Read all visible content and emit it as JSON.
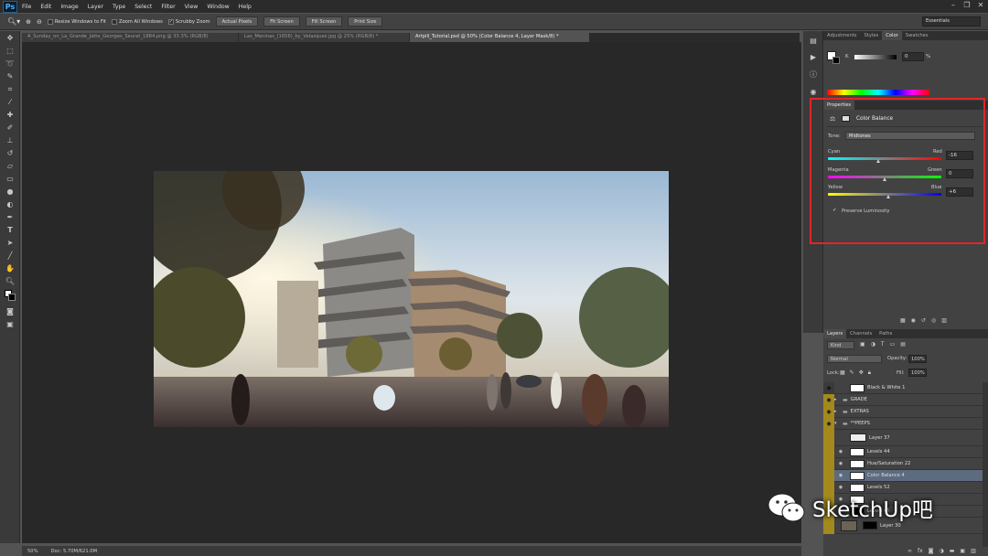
{
  "app": {
    "logo": "Ps"
  },
  "menu": [
    "File",
    "Edit",
    "Image",
    "Layer",
    "Type",
    "Select",
    "Filter",
    "View",
    "Window",
    "Help"
  ],
  "options": {
    "resize_windows": "Resize Windows to Fit",
    "zoom_all": "Zoom All Windows",
    "scrubby": "Scrubby Zoom",
    "actual_pixels": "Actual Pixels",
    "fit_screen": "Fit Screen",
    "fill_screen": "Fill Screen",
    "print_size": "Print Size",
    "workspace": "Essentials"
  },
  "tabs": [
    "A_Sunday_on_La_Grande_Jatte_Georges_Seurat_1884.png @ 33.3% (RGB/8)",
    "Las_Meninas_(1656)_by_Velazquez.jpg @ 25% (RGB/8) *",
    "Artpill_Tutorial.psd @ 50% (Color Balance 4, Layer Mask/8) *"
  ],
  "status": {
    "zoom": "50%",
    "doc": "Doc: 5.70M/621.0M"
  },
  "color_panel": {
    "tabs": [
      "Adjustments",
      "Styles",
      "Color",
      "Swatches"
    ],
    "k_label": "K",
    "k_value": "0",
    "pct": "%"
  },
  "properties": {
    "tab": "Properties",
    "title": "Color Balance",
    "tone_label": "Tone:",
    "tone_value": "Midtones",
    "cyan": "Cyan",
    "red": "Red",
    "cyan_red_value": "-16",
    "magenta": "Magenta",
    "green": "Green",
    "magenta_green_value": "0",
    "yellow": "Yellow",
    "blue": "Blue",
    "yellow_blue_value": "+6",
    "preserve": "Preserve Luminosity"
  },
  "layers_panel": {
    "tabs": [
      "Layers",
      "Channels",
      "Paths"
    ],
    "kind": "Kind",
    "blend": "Normal",
    "opacity_label": "Opacity:",
    "opacity": "100%",
    "lock_label": "Lock:",
    "fill_label": "Fill:",
    "fill": "100%",
    "layers": [
      "Black & White 1",
      "GRADE",
      "EXTRAS",
      "**PEEPS",
      "Layer 37",
      "Levels 44",
      "Hue/Saturation 22",
      "Color Balance 4",
      "Levels 52",
      "",
      "Levels 45",
      "Layer 30"
    ]
  },
  "watermark": "SketchUp吧",
  "colors": {
    "accent_red": "#e0262a",
    "layer_eye": "#a48a1d"
  }
}
